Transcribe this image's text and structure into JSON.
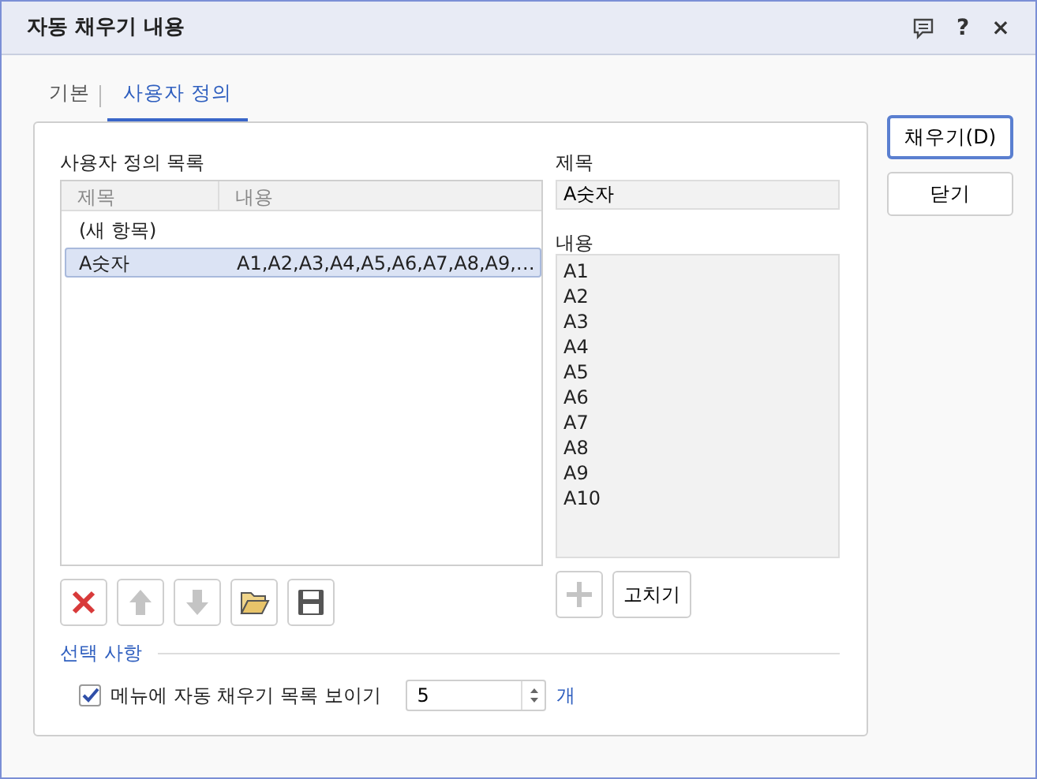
{
  "window": {
    "title": "자동 채우기 내용",
    "help": "?",
    "close": "×"
  },
  "tabs": [
    {
      "label": "기본",
      "selected": false
    },
    {
      "label": "사용자 정의",
      "selected": true
    }
  ],
  "list": {
    "label": "사용자 정의 목록",
    "columns": [
      "제목",
      "내용"
    ],
    "rows": [
      {
        "title": "(새 항목)",
        "selected": false
      },
      {
        "title": "A숫자",
        "content": "A1,A2,A3,A4,A5,A6,A7,A8,A9,…",
        "selected": true
      }
    ]
  },
  "list_tools": [
    {
      "kind": "delete",
      "disabled": false
    },
    {
      "kind": "up",
      "disabled": true
    },
    {
      "kind": "down",
      "disabled": true
    },
    {
      "kind": "open",
      "disabled": false
    },
    {
      "kind": "save",
      "disabled": false
    }
  ],
  "detail": {
    "title_label": "제목",
    "title_value": "A숫자",
    "content_label": "내용",
    "content_lines": [
      "A1",
      "A2",
      "A3",
      "A4",
      "A5",
      "A6",
      "A7",
      "A8",
      "A9",
      "A10"
    ],
    "add_disabled": true,
    "edit_button": "고치기"
  },
  "options": {
    "heading": "선택 사항",
    "show_in_menu": {
      "label": "메뉴에 자동 채우기 목록 보이기",
      "checked": true
    },
    "count": {
      "value": "5",
      "unit": "개"
    }
  },
  "buttons": [
    {
      "label": "채우기(D)",
      "default": true
    },
    {
      "label": "닫기",
      "default": false
    }
  ]
}
